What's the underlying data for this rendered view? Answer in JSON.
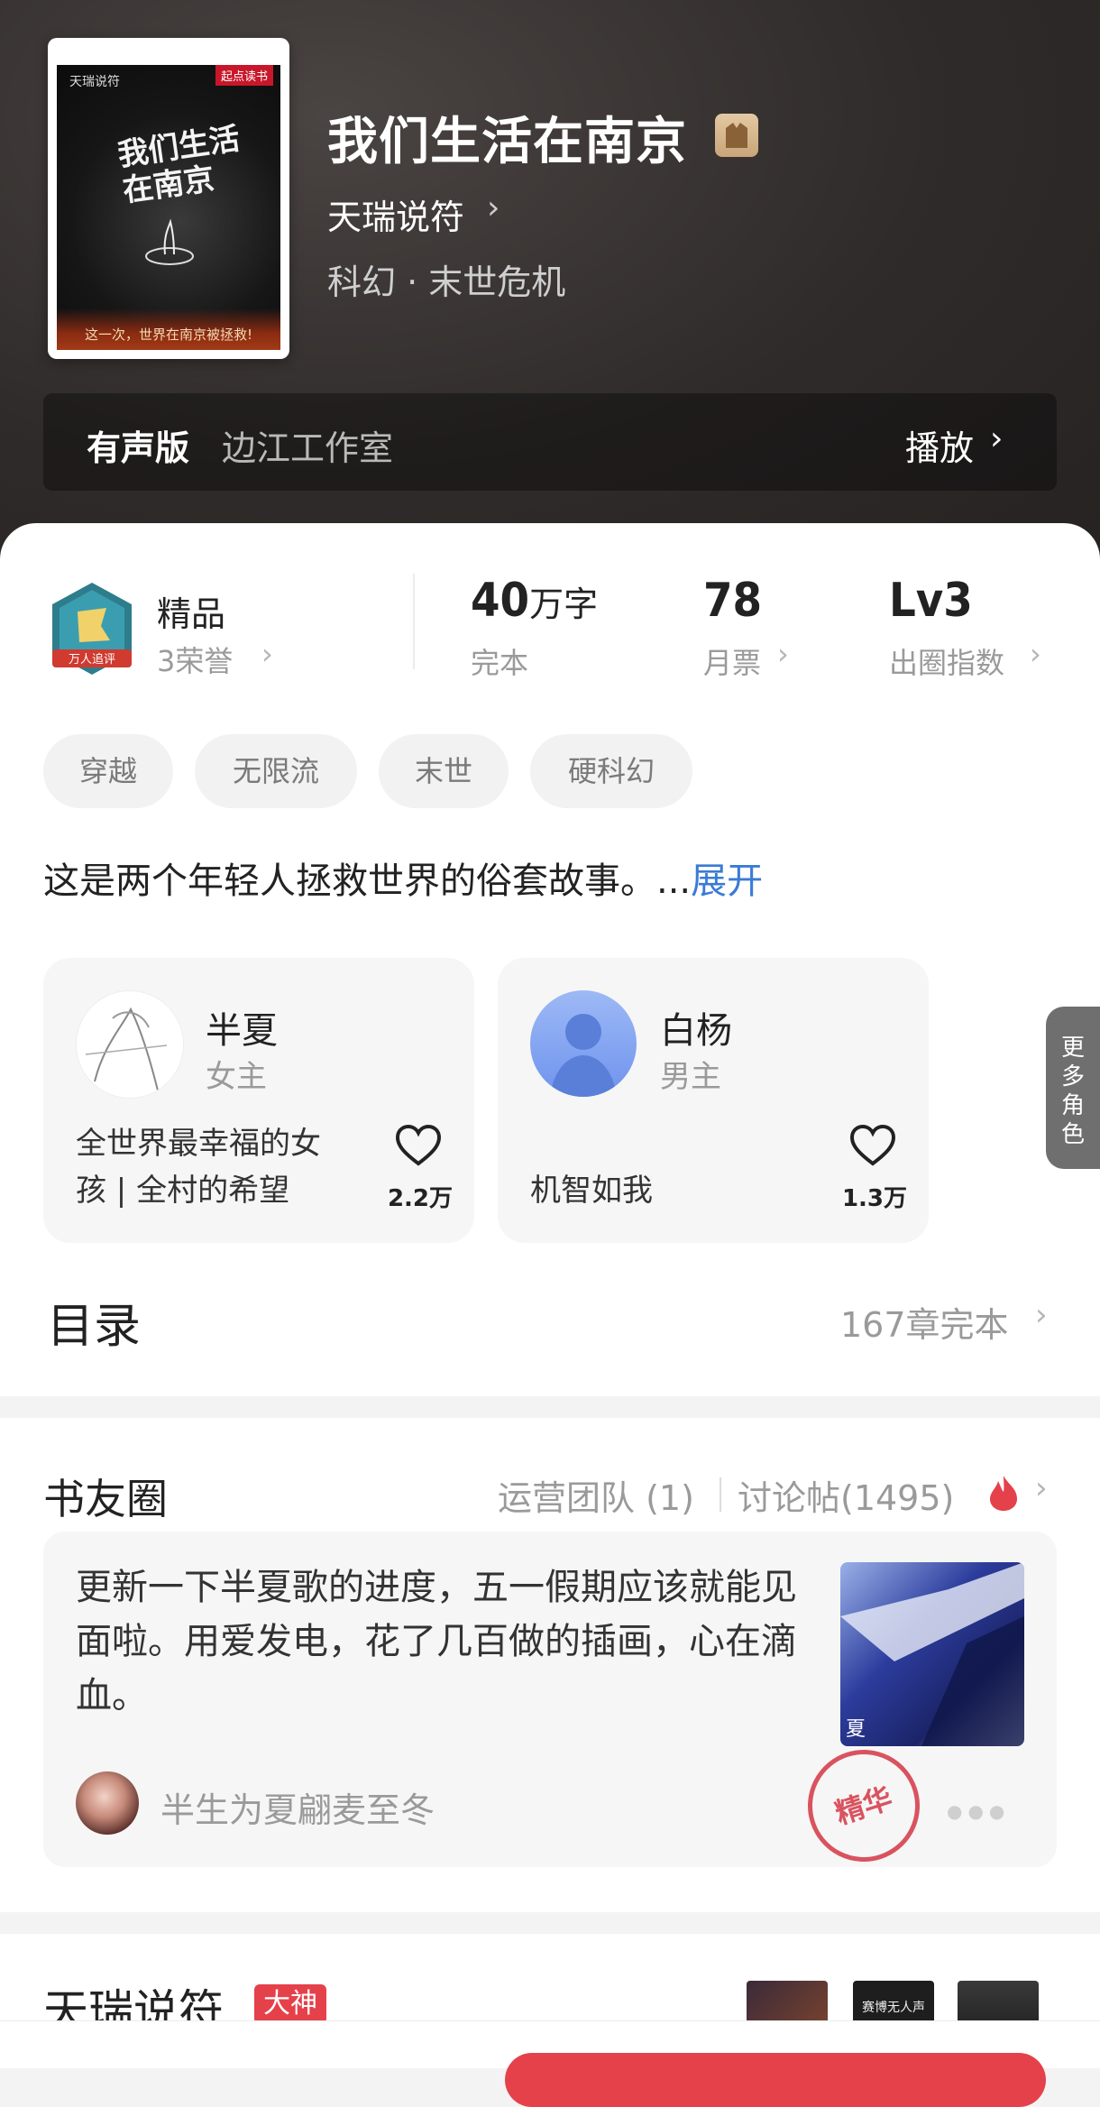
{
  "book": {
    "cover": {
      "top_text": "天瑞说符",
      "badge": "起点读书",
      "title": "我们生活在南京",
      "bottom_text": "这一次，世界在南京被拯救!"
    },
    "title": "我们生活在南京",
    "author": "天瑞说符",
    "genre": "科幻 · 末世危机"
  },
  "audio": {
    "label": "有声版",
    "studio": "边江工作室",
    "play_label": "播放"
  },
  "honor": {
    "label": "精品",
    "count": "3荣誉",
    "icon_text": "万人追评"
  },
  "stats": [
    {
      "value": "40",
      "unit": "万字",
      "sub": "完本"
    },
    {
      "value": "78",
      "unit": "",
      "sub": "月票"
    },
    {
      "value": "Lv3",
      "unit": "",
      "sub": "出圈指数"
    }
  ],
  "tags": [
    "穿越",
    "无限流",
    "末世",
    "硬科幻"
  ],
  "intro": {
    "text": "这是两个年轻人拯救世界的俗套故事。...",
    "expand": "展开"
  },
  "roles": [
    {
      "name": "半夏",
      "type": "女主",
      "desc": "全世界最幸福的女孩 | 全村的希望",
      "likes": "2.2万"
    },
    {
      "name": "白杨",
      "type": "男主",
      "desc": "机智如我",
      "likes": "1.3万"
    }
  ],
  "more_roles": "更多角色",
  "toc": {
    "title": "目录",
    "meta": "167章完本"
  },
  "circle": {
    "title": "书友圈",
    "team": "运营团队 (1)",
    "posts": "讨论帖(1495)",
    "post": {
      "text": "更新一下半夏歌的进度，五一假期应该就能见面啦。用爱发电，花了几百做的插画，心在滴血。",
      "user": "半生为夏翩麦至冬",
      "stamp": "精华",
      "image_caption": "夏"
    }
  },
  "author_section": {
    "name": "天瑞说符",
    "badge": "大神",
    "mini_cover_text": "赛博无人声"
  },
  "colors": {
    "accent": "#e5414b",
    "link": "#3a7bd5",
    "hero_bg": "#2f2b2a"
  },
  "icons": [
    "chevron-right-icon",
    "heart-icon",
    "fire-icon",
    "honor-badge-icon",
    "author-badge-icon"
  ]
}
